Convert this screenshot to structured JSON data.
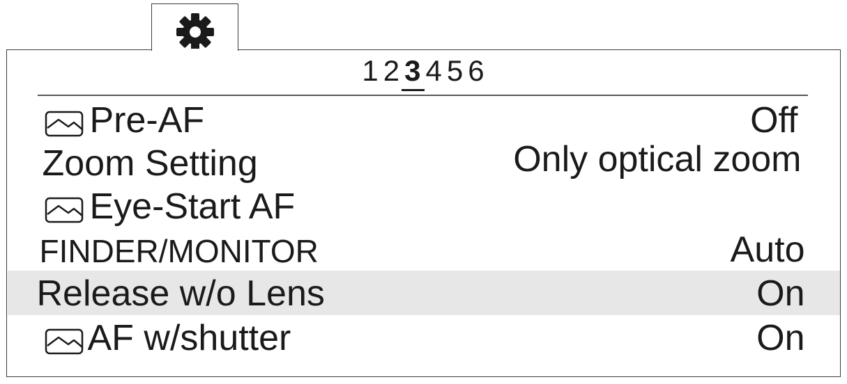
{
  "tab": {
    "icon": "gear-icon"
  },
  "pages": {
    "numbers": [
      "1",
      "2",
      "3",
      "4",
      "5",
      "6"
    ],
    "current": "3"
  },
  "menu": {
    "items": [
      {
        "label": "Pre-AF",
        "value": "Off",
        "icon": "still-image-icon",
        "selected": false
      },
      {
        "label": "Zoom Setting",
        "value": "Only optical zoom",
        "icon": "",
        "selected": false
      },
      {
        "label": "Eye-Start AF",
        "value": "",
        "icon": "still-image-icon",
        "selected": false
      },
      {
        "label": "FINDER/MONITOR",
        "value": "Auto",
        "icon": "",
        "selected": false
      },
      {
        "label": "Release w/o Lens",
        "value": "On",
        "icon": "",
        "selected": true
      },
      {
        "label": "AF w/shutter",
        "value": "On",
        "icon": "still-image-icon",
        "selected": false
      }
    ]
  },
  "colors": {
    "selected_row": "#e6e7e6",
    "text": "#1a1a1a",
    "border": "#3a3a3a"
  }
}
